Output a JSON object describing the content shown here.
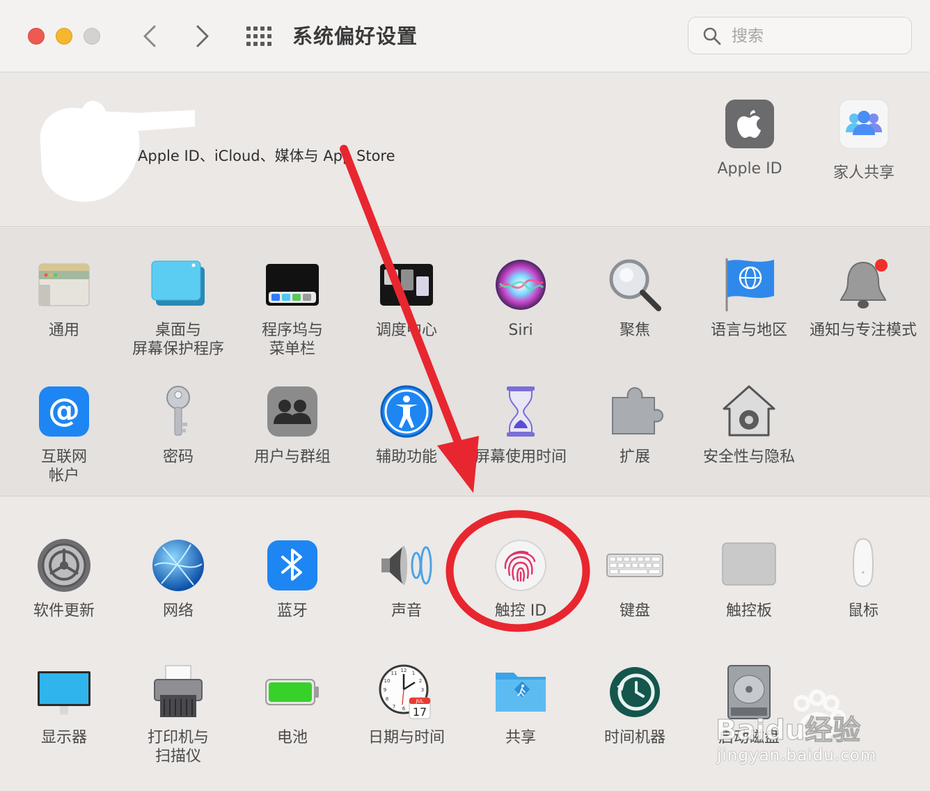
{
  "window": {
    "title": "系统偏好设置",
    "search_placeholder": "搜索"
  },
  "account": {
    "subtitle": "Apple ID、iCloud、媒体与 App Store",
    "items": [
      {
        "label": "Apple ID",
        "icon": "apple-icon"
      },
      {
        "label": "家人共享",
        "icon": "family-sharing-icon"
      }
    ]
  },
  "panes": {
    "general": "通用",
    "desktop": "桌面与\n屏幕保护程序",
    "dock": "程序坞与\n菜单栏",
    "mission": "调度中心",
    "siri": "Siri",
    "spotlight": "聚焦",
    "language": "语言与地区",
    "notifications": "通知与专注模式",
    "internet": "互联网\n帐户",
    "passwords": "密码",
    "users": "用户与群组",
    "accessibility": "辅助功能",
    "screentime": "屏幕使用时间",
    "extensions": "扩展",
    "security": "安全性与隐私",
    "update": "软件更新",
    "network": "网络",
    "bluetooth": "蓝牙",
    "sound": "声音",
    "touchid": "触控 ID",
    "keyboard": "键盘",
    "trackpad": "触控板",
    "mouse": "鼠标",
    "displays": "显示器",
    "printers": "打印机与\n扫描仪",
    "battery": "电池",
    "datetime": "日期与时间",
    "sharing": "共享",
    "timemachine": "时间机器",
    "startup": "启动磁盘"
  },
  "calendar_icon": {
    "month": "JUL",
    "day": "17",
    "clock": [
      "12",
      "1",
      "2",
      "3",
      "4",
      "5",
      "6",
      "7",
      "8",
      "9",
      "10",
      "11"
    ]
  },
  "watermark": {
    "brand": "Baidu经验",
    "url": "jingyan.baidu.com"
  },
  "colors": {
    "annotation_red": "#e8262f",
    "accent_blue": "#1a82f7"
  }
}
